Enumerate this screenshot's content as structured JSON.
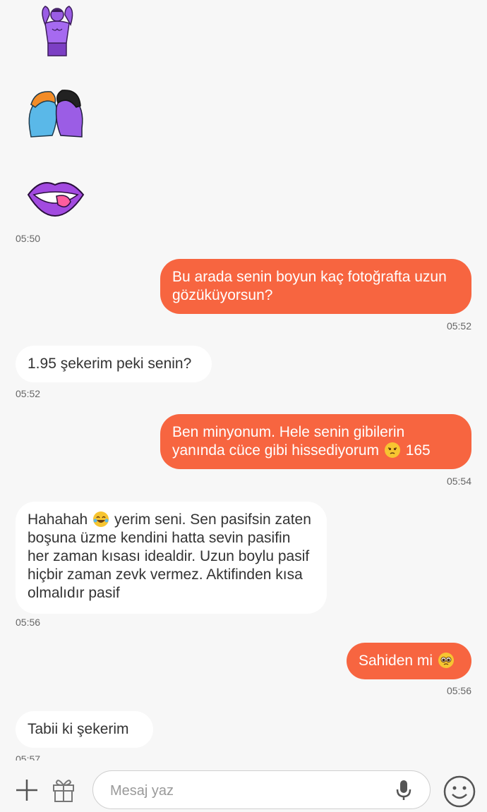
{
  "messages": [
    {
      "time": "05:50"
    },
    {
      "text": "Bu arada senin boyun kaç fotoğrafta uzun gözüküyorsun?",
      "time": "05:52"
    },
    {
      "text": "1.95 şekerim peki senin?",
      "time": "05:52"
    },
    {
      "text_before": "Ben minyonum. Hele senin gibilerin yanında cüce gibi hissediyorum",
      "emoji": "unamused-face-emoji",
      "text_after": "165",
      "time": "05:54"
    },
    {
      "text_before": "Hahahah",
      "emoji": "tears-of-joy-emoji",
      "text_after": "yerim seni. Sen pasifsin zaten boşuna üzme kendini hatta sevin pasifin her zaman kısası idealdir. Uzun boylu pasif hiçbir zaman zevk vermez. Aktifinden kısa olmalıdır pasif",
      "time": "05:56"
    },
    {
      "text": "Sahiden mi",
      "emoji": "pleading-face-emoji",
      "time": "05:56"
    },
    {
      "text": "Tabii ki şekerim",
      "time": "05:57"
    }
  ],
  "stickers": [
    "muscle-man-sticker",
    "kissing-couple-sticker",
    "lips-tongue-sticker"
  ],
  "composer": {
    "placeholder": "Mesaj yaz"
  },
  "colors": {
    "outgoing": "#f76540",
    "incoming": "#ffffff",
    "background": "#f7f7f7",
    "sticker_purple": "#9b5de5"
  }
}
